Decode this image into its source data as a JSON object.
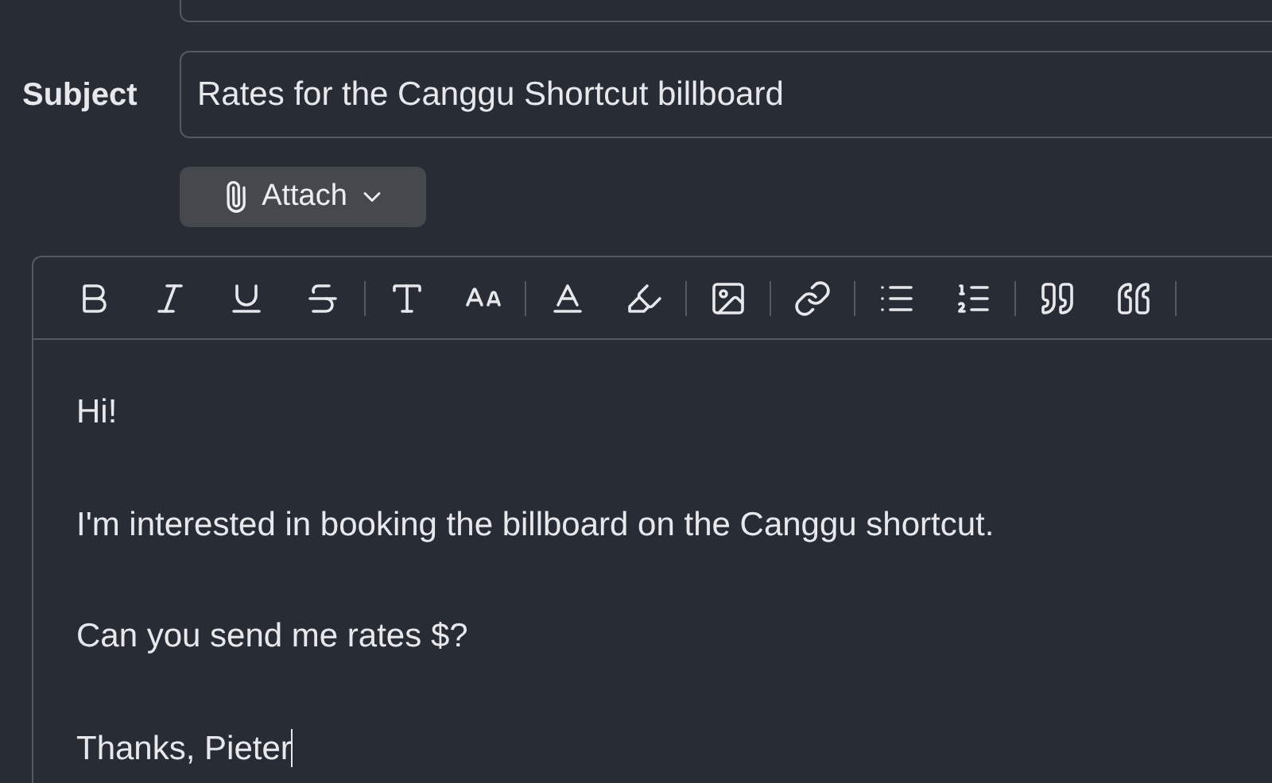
{
  "subject": {
    "label": "Subject",
    "value": "Rates for the Canggu Shortcut billboard"
  },
  "attach_button": {
    "label": "Attach"
  },
  "toolbar": [
    {
      "kind": "bold"
    },
    {
      "kind": "italic"
    },
    {
      "kind": "underline"
    },
    {
      "kind": "strike"
    },
    {
      "kind": "sep"
    },
    {
      "kind": "font"
    },
    {
      "kind": "size"
    },
    {
      "kind": "sep"
    },
    {
      "kind": "color"
    },
    {
      "kind": "highlight"
    },
    {
      "kind": "sep"
    },
    {
      "kind": "image"
    },
    {
      "kind": "sep"
    },
    {
      "kind": "link"
    },
    {
      "kind": "sep"
    },
    {
      "kind": "bullets"
    },
    {
      "kind": "numbers"
    },
    {
      "kind": "sep"
    },
    {
      "kind": "quote_open"
    },
    {
      "kind": "quote_close"
    },
    {
      "kind": "sep"
    }
  ],
  "body": [
    "Hi!",
    "I'm interested in booking the billboard on the Canggu shortcut.",
    "Can you send me rates $?",
    "Thanks, Pieter"
  ]
}
